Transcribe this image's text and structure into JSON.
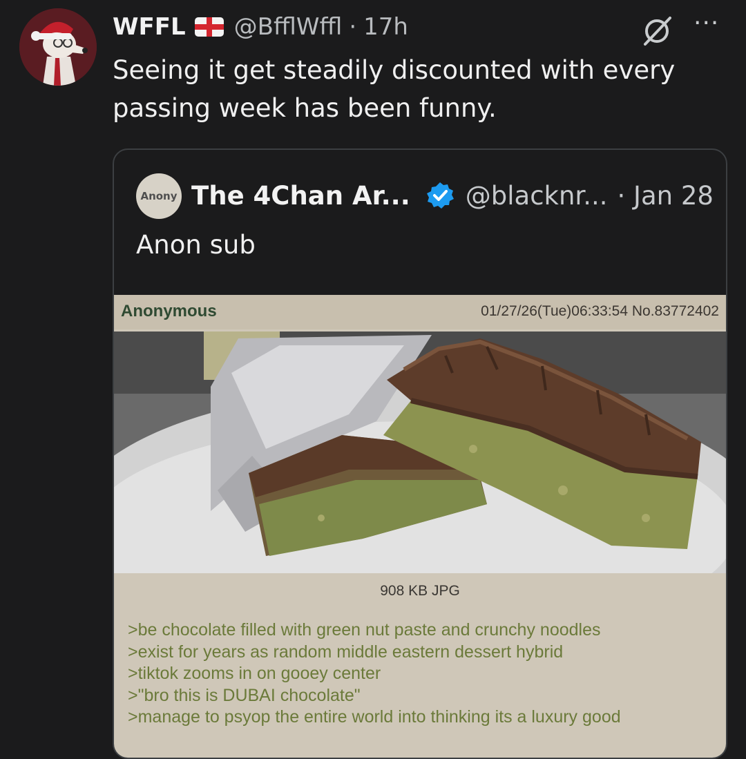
{
  "tweet": {
    "author_name": "WFFL",
    "flag_icon": "england-flag-icon",
    "handle": "@BfflWffl",
    "separator": "·",
    "time": "17h",
    "text": "Seeing it get steadily discounted with every passing week has been funny.",
    "status_icon": "no-symbol-icon",
    "more_label": "···"
  },
  "quoted_tweet": {
    "avatar_text": "Anony",
    "author_name": "The 4Chan Ar...",
    "verified_icon": "verified-badge-icon",
    "handle": "@blacknr...",
    "date": "· Jan 28",
    "text": "Anon sub"
  },
  "post": {
    "poster": "Anonymous",
    "meta": "01/27/26(Tue)06:33:54 No.83772402",
    "file_info": "908 KB JPG",
    "lines": [
      ">be chocolate filled with green nut paste and crunchy noodles",
      ">exist for years as random middle eastern dessert hybrid",
      ">tiktok zooms in on gooey center",
      ">\"bro this is DUBAI chocolate\"",
      ">manage to psyop the entire world into thinking its a luxury good"
    ]
  },
  "colors": {
    "background": "#1b1b1c",
    "greentext": "#6b7a3a",
    "post_bg": "#cfc7b8",
    "verified": "#1d9bf0"
  }
}
